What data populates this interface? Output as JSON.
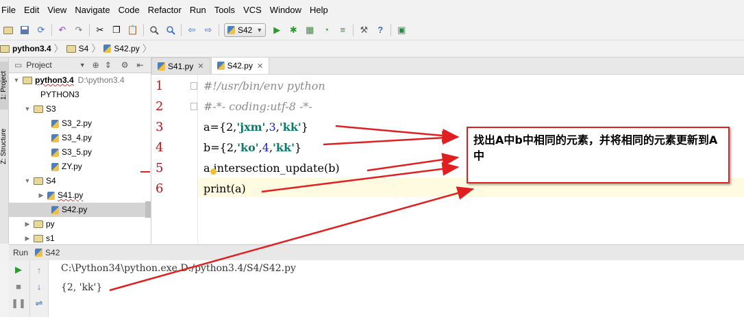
{
  "menu": [
    "File",
    "Edit",
    "View",
    "Navigate",
    "Code",
    "Refactor",
    "Run",
    "Tools",
    "VCS",
    "Window",
    "Help"
  ],
  "toolbar": {
    "run_config": "S42"
  },
  "breadcrumbs": [
    "python3.4",
    "S4",
    "S42.py"
  ],
  "project": {
    "header": "Project",
    "root": {
      "name": "python3.4",
      "path": "D:\\python3.4"
    },
    "rows": [
      {
        "label": "PYTHON3"
      },
      {
        "label": "S3"
      },
      {
        "label": "S3_2.py"
      },
      {
        "label": "S3_4.py"
      },
      {
        "label": "S3_5.py"
      },
      {
        "label": "ZY.py"
      },
      {
        "label": "S4"
      },
      {
        "label": "S41.py"
      },
      {
        "label": "S42.py"
      },
      {
        "label": "py"
      },
      {
        "label": "s1"
      }
    ]
  },
  "side_tabs": {
    "project": "1: Project",
    "structure": "Z: Structure"
  },
  "editor": {
    "tabs": [
      {
        "label": "S41.py",
        "active": false
      },
      {
        "label": "S42.py",
        "active": true
      }
    ],
    "line_numbers": [
      "1",
      "2",
      "3",
      "4",
      "5",
      "6"
    ],
    "code": {
      "l1": "#!/usr/bin/env python",
      "l2": "#-*- coding:utf-8 -*-",
      "l3": {
        "a": "a={2,",
        "b": "'jxm'",
        "c": ",",
        "d": "3",
        "e": ",",
        "f": "'kk'",
        "g": "}"
      },
      "l4": {
        "a": "b={2,",
        "b": "'ko'",
        "c": ",",
        "d": "4",
        "e": ",",
        "f": "'kk'",
        "g": "}"
      },
      "l5": "a.intersection_update(b)",
      "l6": "print(a)"
    }
  },
  "annotation": {
    "text": "找出A中b中相同的元素，并将相同的元素更新到A中",
    "color": "#e02020"
  },
  "run": {
    "header_label": "Run",
    "config": "S42",
    "console": [
      "C:\\Python34\\python.exe D:/python3.4/S4/S42.py",
      "{2, 'kk'}"
    ]
  },
  "icons": [
    "folder-open-icon",
    "save-icon",
    "sync-icon",
    "undo-icon",
    "redo-icon",
    "cut-icon",
    "copy-icon",
    "paste-icon",
    "find-icon",
    "replace-icon",
    "back-icon",
    "forward-icon",
    "run-icon",
    "debug-icon",
    "coverage-icon",
    "profile-icon",
    "concurrency-icon",
    "settings-icon",
    "help-icon",
    "sdk-icon"
  ]
}
